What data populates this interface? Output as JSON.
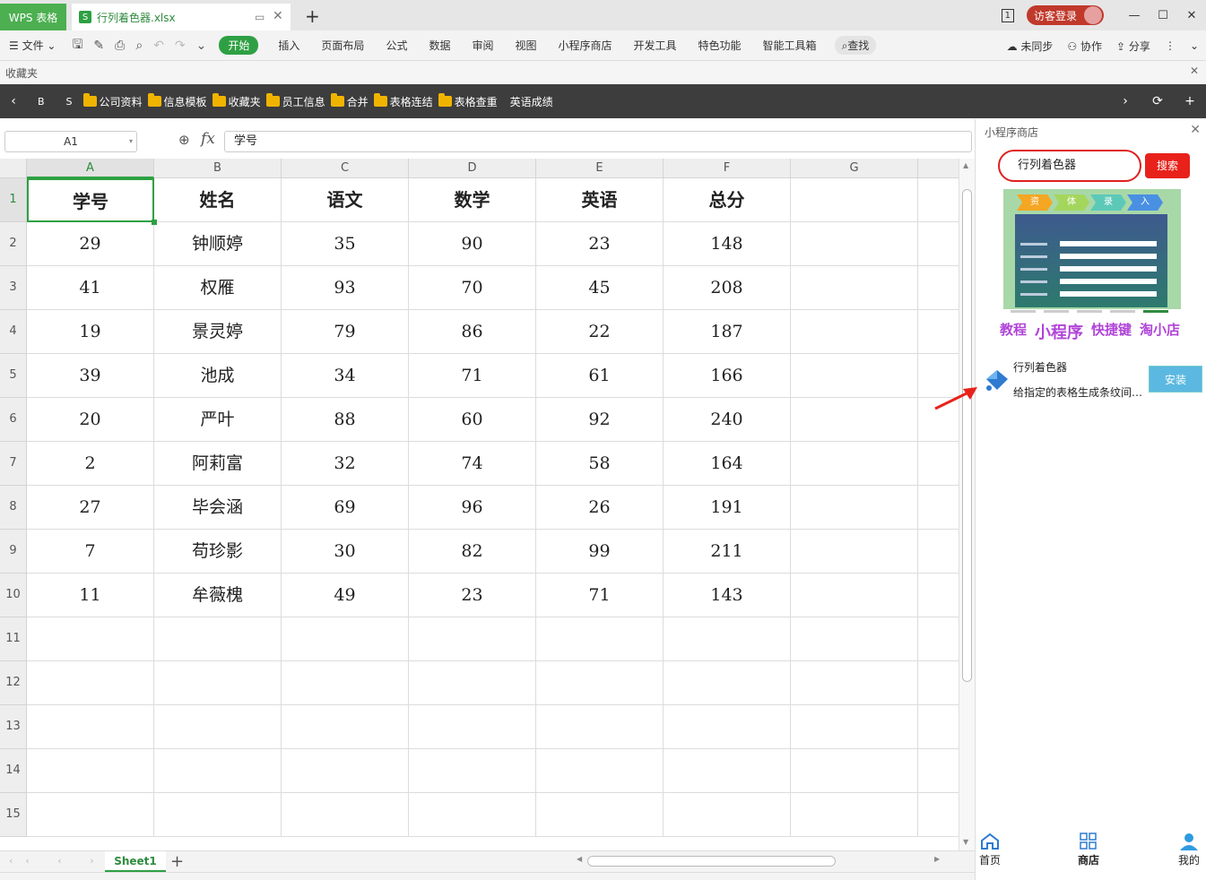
{
  "titlebar": {
    "app_tab": "WPS 表格",
    "file_tab": "行列着色器.xlsx",
    "file_icon": "S",
    "login": "访客登录",
    "page_indicator": "1"
  },
  "menubar": {
    "file": "文件",
    "tabs": [
      "开始",
      "插入",
      "页面布局",
      "公式",
      "数据",
      "审阅",
      "视图",
      "小程序商店",
      "开发工具",
      "特色功能",
      "智能工具箱"
    ],
    "find": "查找",
    "sync": "未同步",
    "collab": "协作",
    "share": "分享"
  },
  "favbar": {
    "label": "收藏夹"
  },
  "bookmarks": {
    "plain": [
      "B",
      "S"
    ],
    "folders": [
      "公司资料",
      "信息模板",
      "收藏夹",
      "员工信息",
      "合并",
      "表格连结",
      "表格查重"
    ],
    "last": "英语成绩"
  },
  "formula": {
    "cell_ref": "A1",
    "fx": "fx",
    "value": "学号"
  },
  "sheet": {
    "columns": [
      "A",
      "B",
      "C",
      "D",
      "E",
      "F",
      "G"
    ],
    "row_numbers": [
      "1",
      "2",
      "3",
      "4",
      "5",
      "6",
      "7",
      "8",
      "9",
      "10",
      "11",
      "12",
      "13",
      "14",
      "15"
    ],
    "header": [
      "学号",
      "姓名",
      "语文",
      "数学",
      "英语",
      "总分"
    ],
    "rows": [
      [
        "29",
        "钟顺婷",
        "35",
        "90",
        "23",
        "148"
      ],
      [
        "41",
        "权雁",
        "93",
        "70",
        "45",
        "208"
      ],
      [
        "19",
        "景灵婷",
        "79",
        "86",
        "22",
        "187"
      ],
      [
        "39",
        "池成",
        "34",
        "71",
        "61",
        "166"
      ],
      [
        "20",
        "严叶",
        "88",
        "60",
        "92",
        "240"
      ],
      [
        "2",
        "阿莉富",
        "32",
        "74",
        "58",
        "164"
      ],
      [
        "27",
        "毕会涵",
        "69",
        "96",
        "26",
        "191"
      ],
      [
        "7",
        "苟珍影",
        "30",
        "82",
        "99",
        "211"
      ],
      [
        "11",
        "牟薇槐",
        "49",
        "23",
        "71",
        "143"
      ]
    ],
    "tab_name": "Sheet1"
  },
  "panel": {
    "title": "小程序商店",
    "search_value": "行列着色器",
    "search_button": "搜索",
    "banner_steps": [
      "资",
      "体",
      "录",
      "入"
    ],
    "links": [
      "教程",
      "小程序",
      "快捷键",
      "淘小店"
    ],
    "plugin_name": "行列着色器",
    "plugin_desc": "给指定的表格生成条纹间隔色",
    "install": "安装",
    "bottom_nav": [
      "首页",
      "商店",
      "我的"
    ]
  },
  "colors": {
    "accent": "#2ea043",
    "dark_bar": "#3d3d3d",
    "search_red": "#e8221b",
    "install_blue": "#5bb8e0",
    "link_purple": "#b044d8"
  }
}
